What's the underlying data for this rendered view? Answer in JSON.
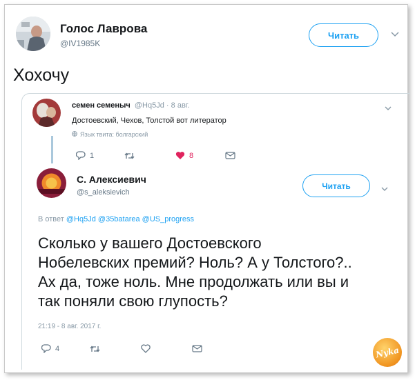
{
  "outer": {
    "name": "Голос Лаврова",
    "handle": "@IV1985K",
    "follow_label": "Читать",
    "text": "Хохочу"
  },
  "reply": {
    "name": "семен семеныч",
    "handle": "@Hq5Jd",
    "dot": "·",
    "date": "8 авг.",
    "text": "Достоевский, Чехов, Толстой вот литератор",
    "lang_note": "Язык твита: болгарский",
    "reply_count": "1",
    "like_count": "8"
  },
  "main": {
    "name": "С. Алексиевич",
    "handle": "@s_aleksievich",
    "follow_label": "Читать",
    "in_reply_prefix": "В ответ",
    "in_reply_handles": "@Hq5Jd @35batarea @US_progress",
    "text_lines": [
      "Сколько у вашего Достоевского",
      "Нобелевских премий? Ноль? А у Толстого?..",
      "Ах да, тоже ноль. Мне продолжать или вы и",
      "так поняли свою глупость?"
    ],
    "timestamp": "21:19 - 8 авг. 2017 г.",
    "reply_count": "4"
  },
  "watermark": "Nyka",
  "colors": {
    "link": "#1da1f2",
    "like": "#e0245e",
    "muted": "#657786"
  }
}
